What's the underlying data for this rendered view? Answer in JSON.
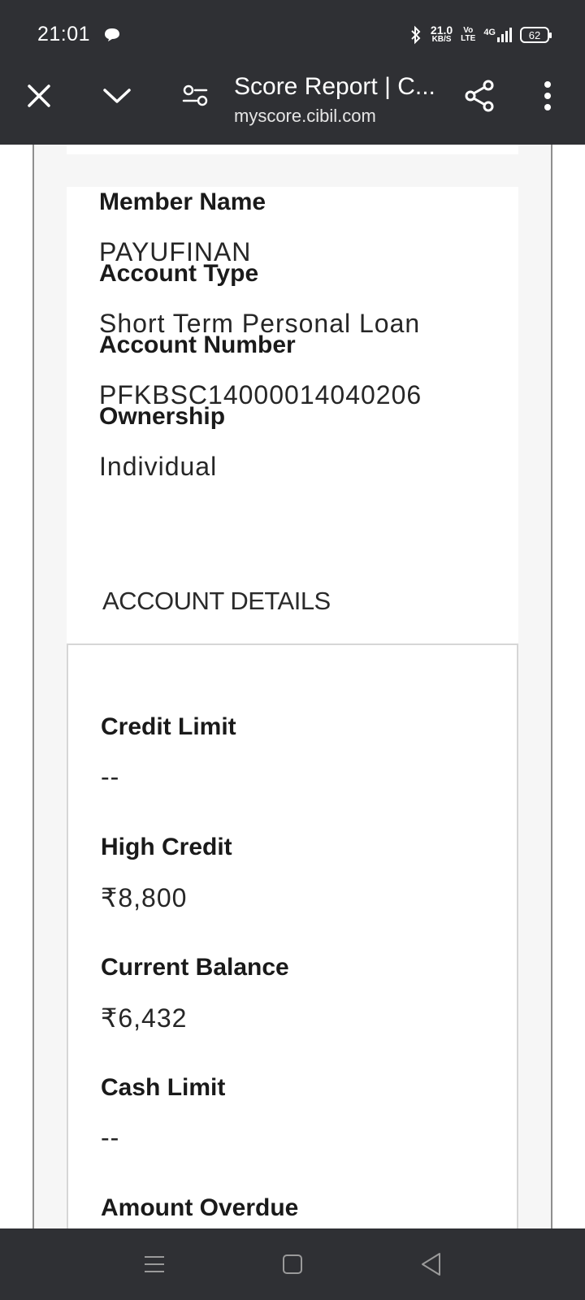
{
  "status_bar": {
    "time": "21:01",
    "net_speed_value": "21.0",
    "net_speed_unit": "KB/S",
    "volte_top": "Vo",
    "volte_bottom": "LTE",
    "network": "4G",
    "battery": "62",
    "icons": [
      "notification-bubble-icon",
      "bluetooth-icon",
      "signal-icon",
      "battery-icon"
    ]
  },
  "toolbar": {
    "title": "Score Report | C...",
    "url": "myscore.cibil.com",
    "icons": [
      "close-icon",
      "chevron-down-icon",
      "tune-icon",
      "share-icon",
      "more-vert-icon"
    ]
  },
  "account_info": [
    {
      "label": "Member Name",
      "value": "PAYUFINAN"
    },
    {
      "label": "Account Type",
      "value": "Short Term Personal Loan"
    },
    {
      "label": "Account Number",
      "value": "PFKBSC14000014040206"
    },
    {
      "label": "Ownership",
      "value": "Individual"
    }
  ],
  "account_details": {
    "heading": "ACCOUNT DETAILS",
    "fields": [
      {
        "label": "Credit Limit",
        "value": "--"
      },
      {
        "label": "High Credit",
        "value": "₹8,800"
      },
      {
        "label": "Current Balance",
        "value": "₹6,432"
      },
      {
        "label": "Cash Limit",
        "value": "--"
      },
      {
        "label": "Amount Overdue",
        "value": ""
      }
    ]
  },
  "nav_bar": {
    "icons": [
      "menu-icon",
      "home-square-icon",
      "back-triangle-icon"
    ]
  }
}
